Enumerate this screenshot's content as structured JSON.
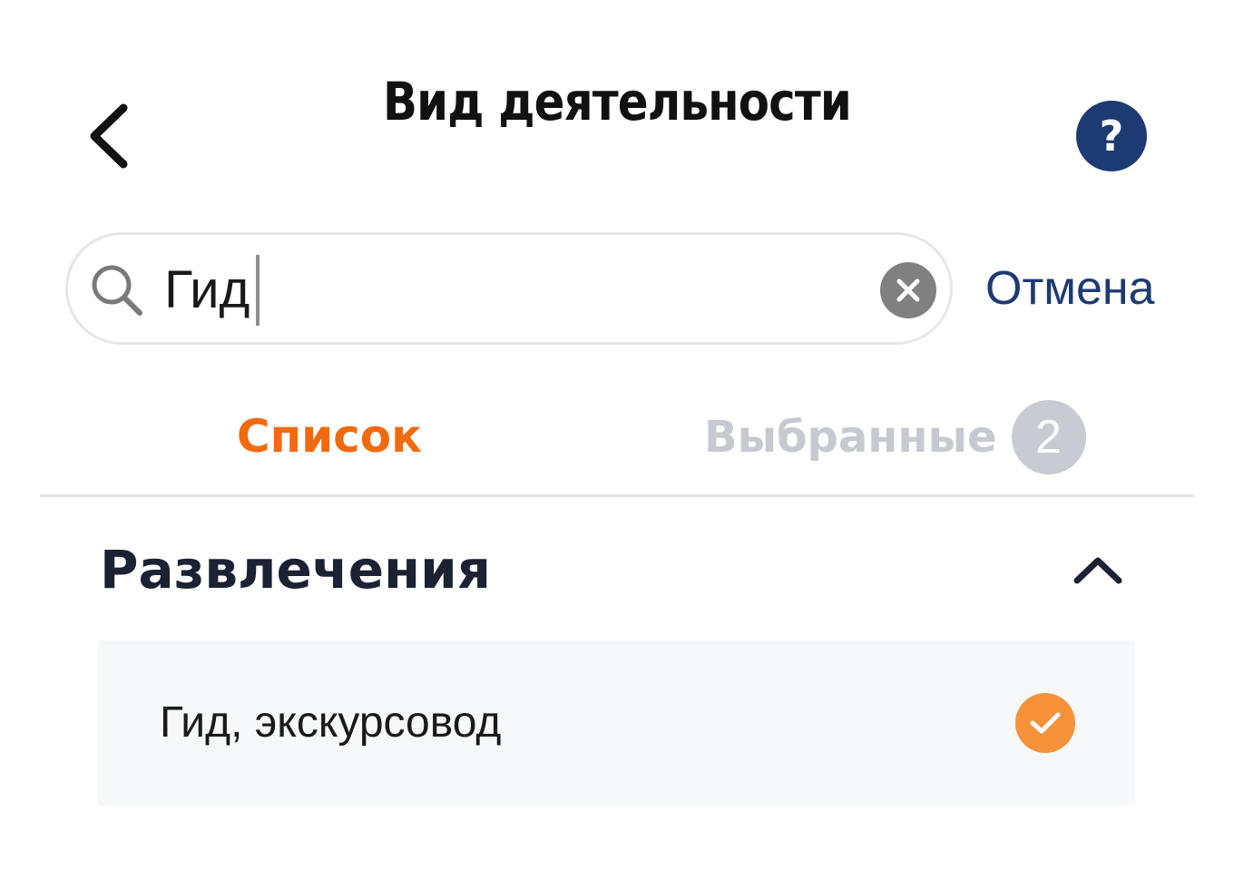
{
  "header": {
    "title": "Вид деятельности",
    "back_icon": "chevron-left-icon",
    "help_label": "?"
  },
  "search": {
    "value": "Гид",
    "placeholder": "",
    "clear_icon": "close-icon",
    "cancel_label": "Отмена"
  },
  "tabs": [
    {
      "label": "Список",
      "active": true
    },
    {
      "label": "Выбранные",
      "active": false,
      "badge": "2"
    }
  ],
  "section": {
    "title": "Развлечения",
    "toggle_icon": "chevron-up-icon",
    "items": [
      {
        "label": "Гид, экскурсовод",
        "selected": true
      }
    ]
  },
  "colors": {
    "accent_orange": "#f26a0f",
    "brand_navy": "#1e3a73",
    "check_orange": "#f5923a",
    "muted_gray": "#c6c9cf"
  }
}
